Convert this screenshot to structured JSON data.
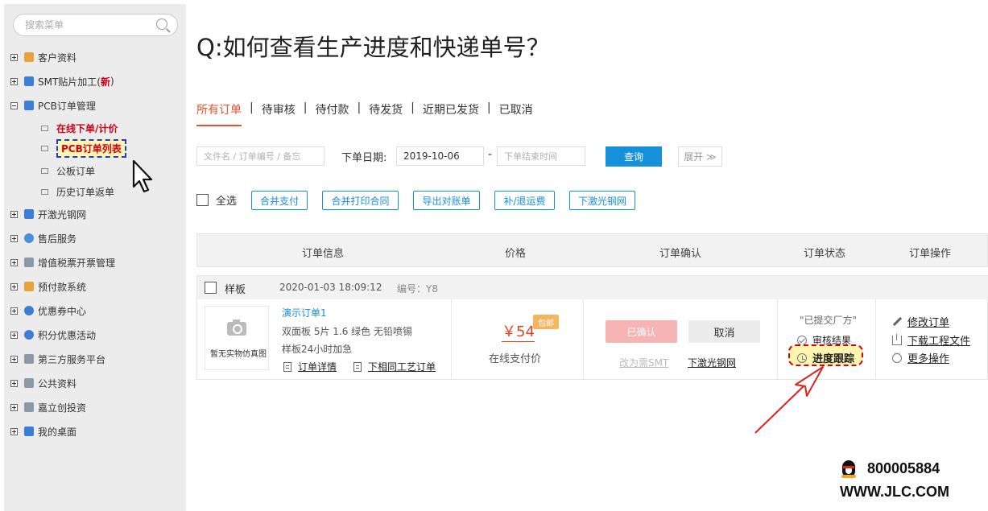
{
  "sidebar": {
    "search_placeholder": "搜索菜单",
    "items": [
      {
        "label": "客户资料",
        "icon": "user-icon",
        "color": "#e8a33a"
      },
      {
        "label": "SMT贴片加工(",
        "new": "新",
        "suffix": ")",
        "icon": "board-icon",
        "color": "#3b7ed6"
      },
      {
        "label": "PCB订单管理",
        "icon": "board-icon",
        "color": "#3b7ed6"
      },
      {
        "label": "开激光钢网",
        "icon": "board-icon",
        "color": "#3b7ed6"
      },
      {
        "label": "售后服务",
        "icon": "person-icon",
        "color": "#4a8fd9"
      },
      {
        "label": "增值税票开票管理",
        "icon": "doc-icon",
        "color": "#8c9aa8"
      },
      {
        "label": "预付款系统",
        "icon": "stack-icon",
        "color": "#e8a33a"
      },
      {
        "label": "优惠券中心",
        "icon": "shield-icon",
        "color": "#3b7ed6"
      },
      {
        "label": "积分优惠活动",
        "icon": "shield-icon",
        "color": "#3b7ed6"
      },
      {
        "label": "第三方服务平台",
        "icon": "window-icon",
        "color": "#8c9aa8"
      },
      {
        "label": "公共资料",
        "icon": "window-icon",
        "color": "#8c9aa8"
      },
      {
        "label": "嘉立创投资",
        "icon": "doc-icon",
        "color": "#8c9aa8"
      },
      {
        "label": "我的桌面",
        "icon": "chat-icon",
        "color": "#3b7ed6"
      }
    ],
    "sub_items": [
      "在线下单/计价",
      "PCB订单列表",
      "公板订单",
      "历史订单返单"
    ]
  },
  "question": "Q:如何查看生产进度和快递单号？",
  "tabs": [
    "所有订单",
    "待审核",
    "待付款",
    "待发货",
    "近期已发货",
    "已取消"
  ],
  "filters": {
    "keyword_placeholder": "文件名 / 订单编号 / 备忘",
    "date_label": "下单日期:",
    "start_date": "2019-10-06",
    "dash": "-",
    "end_placeholder": "下单结束时间",
    "query_label": "查询",
    "expand_label": "展开 ≫"
  },
  "actions": {
    "select_all": "全选",
    "buttons": [
      "合并支付",
      "合并打印合同",
      "导出对账单",
      "补/退运费",
      "下激光钢网"
    ]
  },
  "table": {
    "headers": [
      "订单信息",
      "价格",
      "订单确认",
      "订单状态",
      "订单操作"
    ]
  },
  "order": {
    "type": "样板",
    "datetime": "2020-01-03 18:09:12",
    "number": "编号：Y8",
    "thumb_text": "暂无实物仿真图",
    "name": "演示订单1",
    "spec1": "双面板   5片   1.6   绿色   无铅喷锡",
    "spec2": "样板24小时加急",
    "detail_link": "订单详情",
    "same_link": "下相同工艺订单",
    "price": "￥54",
    "free_shipping": "包邮",
    "pay_method": "在线支付价",
    "confirmed": "已确认",
    "cancel": "取消",
    "to_smt": "改为需SMT",
    "stencil": "下激光钢网",
    "status": "\"已提交厂方\"",
    "review": "审核结果",
    "track": "进度跟踪",
    "ops": [
      "修改订单",
      "下载工程文件",
      "更多操作"
    ]
  },
  "footer": {
    "qq": "800005884",
    "url": "WWW.JLC.COM"
  },
  "colors": {
    "accent_blue": "#1790dc",
    "accent_orange": "#e9512c",
    "highlight_red": "#d0021b"
  }
}
